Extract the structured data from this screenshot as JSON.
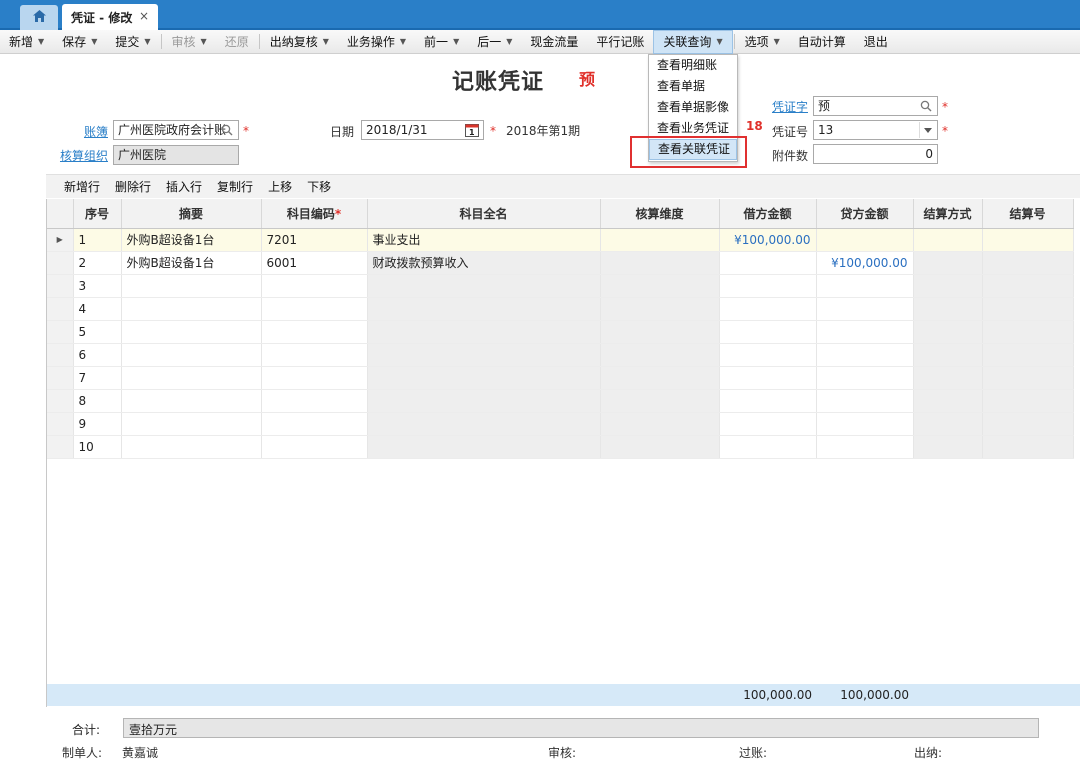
{
  "tabs": {
    "active_label": "凭证 - 修改",
    "close_glyph": "×"
  },
  "toolbar": {
    "items": [
      {
        "label": "新增",
        "caret": true,
        "disabled": false
      },
      {
        "label": "保存",
        "caret": true,
        "disabled": false
      },
      {
        "label": "提交",
        "caret": true,
        "disabled": false
      },
      {
        "label": "审核",
        "caret": true,
        "disabled": true
      },
      {
        "label": "还原",
        "caret": false,
        "disabled": true
      },
      {
        "label": "出纳复核",
        "caret": true,
        "disabled": false
      },
      {
        "label": "业务操作",
        "caret": true,
        "disabled": false
      },
      {
        "label": "前一",
        "caret": true,
        "disabled": false
      },
      {
        "label": "后一",
        "caret": true,
        "disabled": false
      },
      {
        "label": "现金流量",
        "caret": false,
        "disabled": false
      },
      {
        "label": "平行记账",
        "caret": false,
        "disabled": false
      },
      {
        "label": "关联查询",
        "caret": true,
        "disabled": false,
        "active": true
      },
      {
        "label": "选项",
        "caret": true,
        "disabled": false
      },
      {
        "label": "自动计算",
        "caret": false,
        "disabled": false
      },
      {
        "label": "退出",
        "caret": false,
        "disabled": false
      }
    ]
  },
  "dropdown": {
    "items": [
      "查看明细账",
      "查看单据",
      "查看单据影像",
      "查看业务凭证",
      "查看关联凭证"
    ],
    "selected_index": 4
  },
  "header": {
    "title": "记账凭证",
    "badge": "预",
    "book_label": "账簿",
    "book_value": "广州医院政府会计账",
    "org_label": "核算组织",
    "org_value": "广州医院",
    "date_label": "日期",
    "date_value": "2018/1/31",
    "period_text": "2018年第1期",
    "voucher_word_label": "凭证字",
    "voucher_word_value": "预",
    "voucher_no_label": "凭证号",
    "voucher_no_value": "13",
    "attachments_label": "附件数",
    "attachments_value": "0",
    "count_note": "18",
    "required_mark": "*",
    "calendar_day": "1"
  },
  "row_toolbar": [
    "新增行",
    "删除行",
    "插入行",
    "复制行",
    "上移",
    "下移"
  ],
  "grid": {
    "columns": [
      "序号",
      "摘要",
      "科目编码",
      "科目全名",
      "核算维度",
      "借方金额",
      "贷方金额",
      "结算方式",
      "结算号"
    ],
    "required_mark": "*",
    "rows": [
      {
        "no": "1",
        "summary": "外购B超设备1台",
        "code": "7201",
        "name": "事业支出",
        "dim": "",
        "debit": "¥100,000.00",
        "credit": "",
        "settle": "",
        "settle_no": ""
      },
      {
        "no": "2",
        "summary": "外购B超设备1台",
        "code": "6001",
        "name": "财政拨款预算收入",
        "dim": "",
        "debit": "",
        "credit": "¥100,000.00",
        "settle": "",
        "settle_no": ""
      },
      {
        "no": "3",
        "summary": "",
        "code": "",
        "name": "",
        "dim": "",
        "debit": "",
        "credit": "",
        "settle": "",
        "settle_no": ""
      },
      {
        "no": "4",
        "summary": "",
        "code": "",
        "name": "",
        "dim": "",
        "debit": "",
        "credit": "",
        "settle": "",
        "settle_no": ""
      },
      {
        "no": "5",
        "summary": "",
        "code": "",
        "name": "",
        "dim": "",
        "debit": "",
        "credit": "",
        "settle": "",
        "settle_no": ""
      },
      {
        "no": "6",
        "summary": "",
        "code": "",
        "name": "",
        "dim": "",
        "debit": "",
        "credit": "",
        "settle": "",
        "settle_no": ""
      },
      {
        "no": "7",
        "summary": "",
        "code": "",
        "name": "",
        "dim": "",
        "debit": "",
        "credit": "",
        "settle": "",
        "settle_no": ""
      },
      {
        "no": "8",
        "summary": "",
        "code": "",
        "name": "",
        "dim": "",
        "debit": "",
        "credit": "",
        "settle": "",
        "settle_no": ""
      },
      {
        "no": "9",
        "summary": "",
        "code": "",
        "name": "",
        "dim": "",
        "debit": "",
        "credit": "",
        "settle": "",
        "settle_no": ""
      },
      {
        "no": "10",
        "summary": "",
        "code": "",
        "name": "",
        "dim": "",
        "debit": "",
        "credit": "",
        "settle": "",
        "settle_no": ""
      }
    ],
    "total_debit": "100,000.00",
    "total_credit": "100,000.00"
  },
  "footer": {
    "sum_label": "合计:",
    "sum_value": "壹拾万元",
    "maker_label": "制单人:",
    "maker_value": "黄嘉诚",
    "auditor_label": "审核:",
    "poster_label": "过账:",
    "cashier_label": "出纳:"
  },
  "colors": {
    "accent": "#2a7fc8",
    "required": "#e0302a",
    "amount": "#2a6fc0",
    "highlight_box": "#e03030"
  }
}
